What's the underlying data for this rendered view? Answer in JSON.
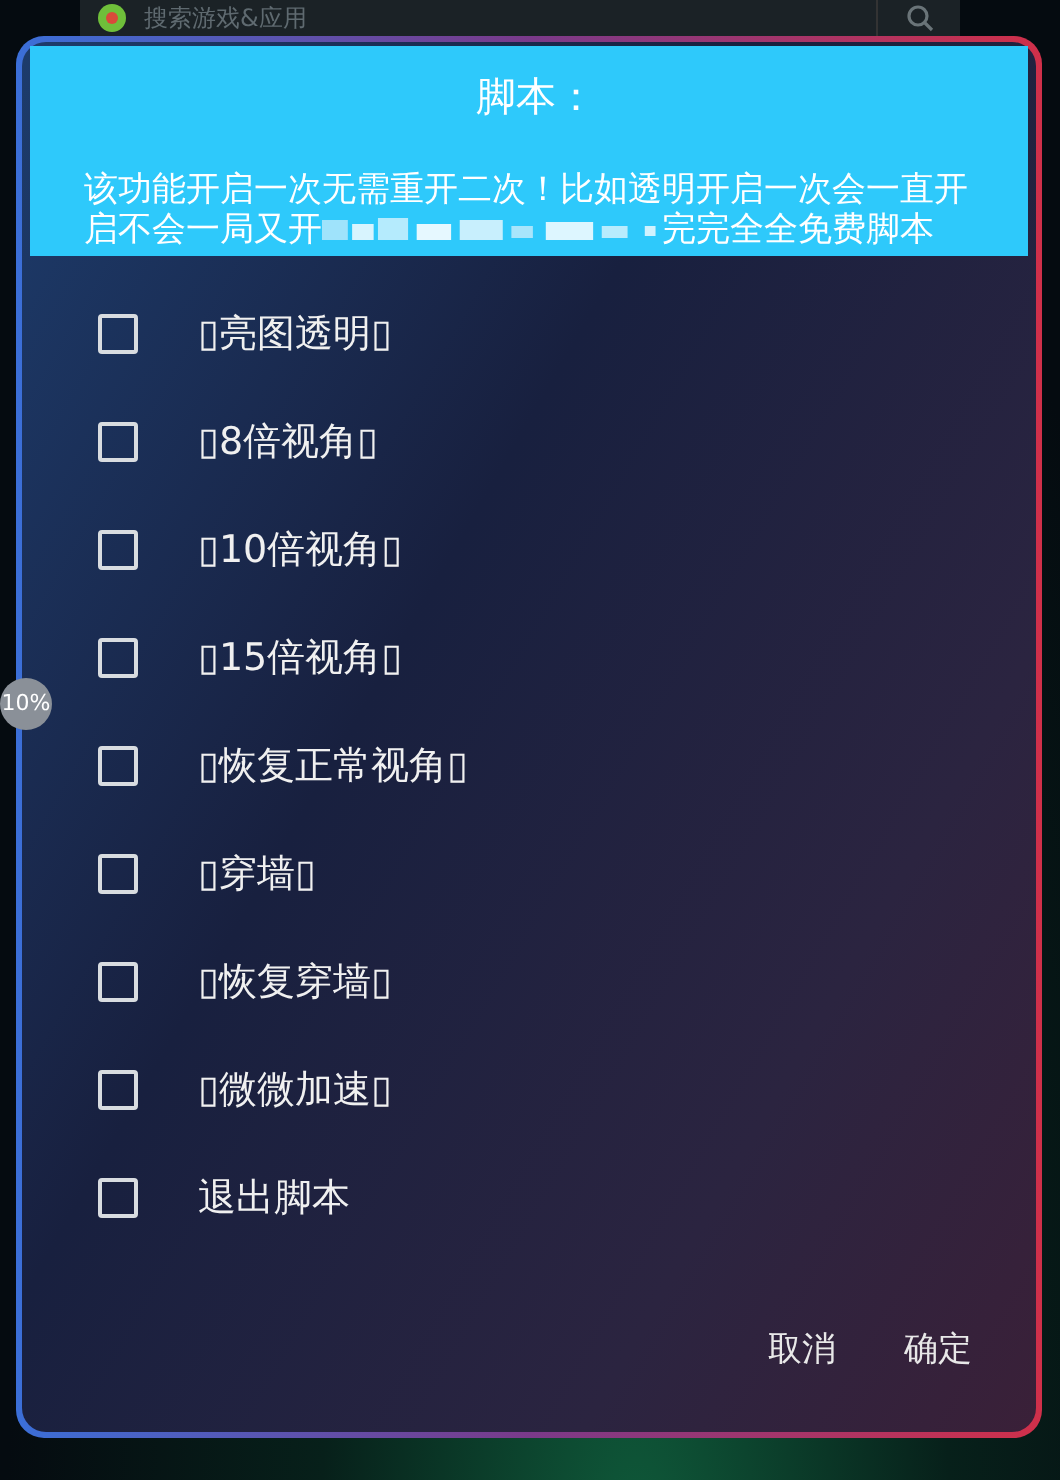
{
  "search_bar": {
    "placeholder": "搜索游戏&应用"
  },
  "floating_badge": {
    "text": "10%"
  },
  "dialog": {
    "title": "脚本：",
    "message_before": "该功能开启一次无需重开二次！比如透明开启一次会一直开启不会一局又开",
    "message_after": "完完全全免费脚本",
    "items": [
      {
        "label": "▯亮图透明▯",
        "checked": false
      },
      {
        "label": "▯8倍视角▯",
        "checked": false
      },
      {
        "label": "▯10倍视角▯",
        "checked": false
      },
      {
        "label": "▯15倍视角▯",
        "checked": false
      },
      {
        "label": "▯恢复正常视角▯",
        "checked": false
      },
      {
        "label": "▯穿墙▯",
        "checked": false
      },
      {
        "label": "▯恢复穿墙▯",
        "checked": false
      },
      {
        "label": "▯微微加速▯",
        "checked": false
      },
      {
        "label": "退出脚本",
        "checked": false
      }
    ],
    "buttons": [
      "取消",
      "确定"
    ]
  }
}
